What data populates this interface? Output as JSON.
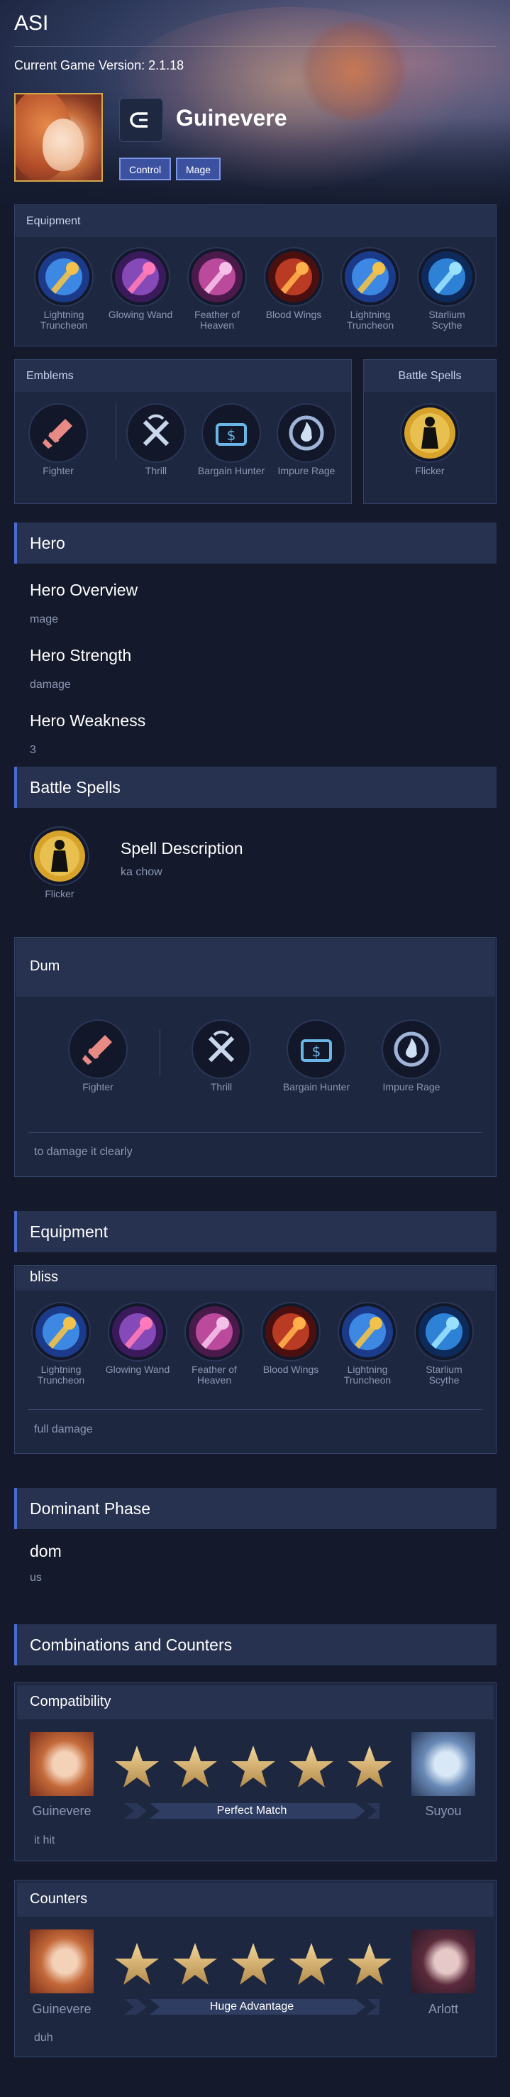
{
  "app": {
    "title": "ASI",
    "version": "Current Game Version: 2.1.18"
  },
  "hero": {
    "name": "Guinevere",
    "tags": [
      "Control",
      "Mage"
    ]
  },
  "equipment_top": {
    "title": "Equipment",
    "items": [
      {
        "name": "Lightning Truncheon",
        "icon": "lightning-truncheon-icon"
      },
      {
        "name": "Glowing Wand",
        "icon": "glowing-wand-icon"
      },
      {
        "name": "Feather of Heaven",
        "icon": "feather-of-heaven-icon"
      },
      {
        "name": "Blood Wings",
        "icon": "blood-wings-icon"
      },
      {
        "name": "Lightning Truncheon",
        "icon": "lightning-truncheon-icon"
      },
      {
        "name": "Starlium Scythe",
        "icon": "starlium-scythe-icon"
      }
    ]
  },
  "emblems_top": {
    "title": "Emblems",
    "main": "Fighter",
    "talents": [
      "Thrill",
      "Bargain Hunter",
      "Impure Rage"
    ]
  },
  "battle_spells_top": {
    "title": "Battle Spells",
    "spell": "Flicker"
  },
  "hero_section": {
    "title": "Hero",
    "overview_label": "Hero Overview",
    "overview_value": "mage",
    "strength_label": "Hero Strength",
    "strength_value": "damage",
    "weakness_label": "Hero Weakness",
    "weakness_value": "3"
  },
  "spells_section": {
    "title": "Battle Spells",
    "spell": "Flicker",
    "desc_label": "Spell Description",
    "desc_value": "ka chow"
  },
  "emblem_build": {
    "title": "Dum",
    "main": "Fighter",
    "talents": [
      "Thrill",
      "Bargain Hunter",
      "Impure Rage"
    ],
    "note": "to damage it clearly"
  },
  "equipment_section": {
    "title": "Equipment",
    "build_name": "bliss",
    "items": [
      "Lightning Truncheon",
      "Glowing Wand",
      "Feather of Heaven",
      "Blood Wings",
      "Lightning Truncheon",
      "Starlium Scythe"
    ],
    "note": "full damage"
  },
  "dominant_phase": {
    "title": "Dominant Phase",
    "label": "dom",
    "value": "us"
  },
  "combos": {
    "title": "Combinations and Counters",
    "compatibility": {
      "title": "Compatibility",
      "hero": "Guinevere",
      "partner": "Suyou",
      "stars": 5,
      "rating": "Perfect Match",
      "note": "it hit"
    },
    "counters": {
      "title": "Counters",
      "hero": "Guinevere",
      "partner": "Arlott",
      "stars": 5,
      "rating": "Huge Advantage",
      "note": "duh"
    }
  },
  "colors": {
    "background": "#141a2c",
    "panel": "#1e2842",
    "accent": "#4a6bd0",
    "gold": "#d2a64a"
  }
}
